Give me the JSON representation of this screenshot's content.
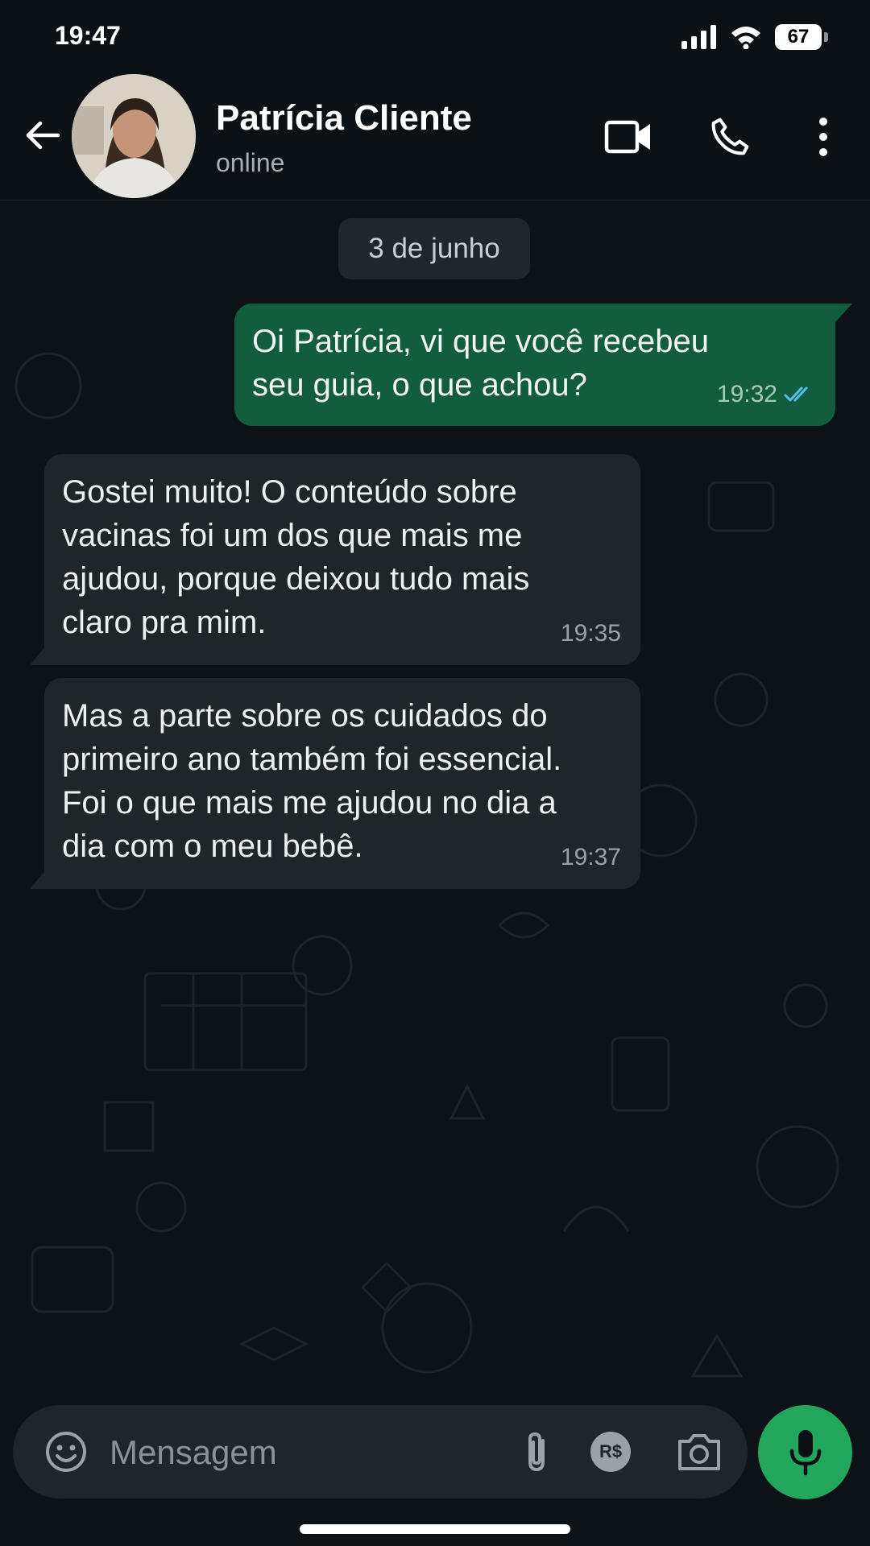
{
  "status_bar": {
    "time": "19:47",
    "battery": "67"
  },
  "header": {
    "contact_name": "Patrícia Cliente",
    "status": "online"
  },
  "chat": {
    "date_separator": "3 de junho",
    "messages": [
      {
        "direction": "outgoing",
        "text": "Oi Patrícia, vi que você recebeu\nseu guia, o que achou?",
        "time": "19:32",
        "read": true
      },
      {
        "direction": "incoming",
        "text": "Gostei muito! O conteúdo sobre\nvacinas foi um dos que mais me\najudou, porque deixou tudo mais\nclaro pra mim.",
        "time": "19:35"
      },
      {
        "direction": "incoming",
        "text": "Mas a parte sobre os cuidados do\nprimeiro ano também foi essencial.\nFoi o que mais me ajudou no dia a\ndia com o meu bebê.",
        "time": "19:37"
      }
    ]
  },
  "composer": {
    "placeholder": "Mensagem",
    "payment_label": "R$"
  },
  "colors": {
    "outgoing_bubble": "#135d3f",
    "incoming_bubble": "#1f2629",
    "accent": "#21a65c",
    "read_ticks": "#53bdeb"
  },
  "icons": [
    "back-arrow-icon",
    "video-call-icon",
    "phone-icon",
    "more-vertical-icon",
    "emoji-icon",
    "attach-icon",
    "payment-icon",
    "camera-icon",
    "mic-icon",
    "signal-icon",
    "wifi-icon",
    "battery-icon",
    "read-ticks-icon"
  ]
}
